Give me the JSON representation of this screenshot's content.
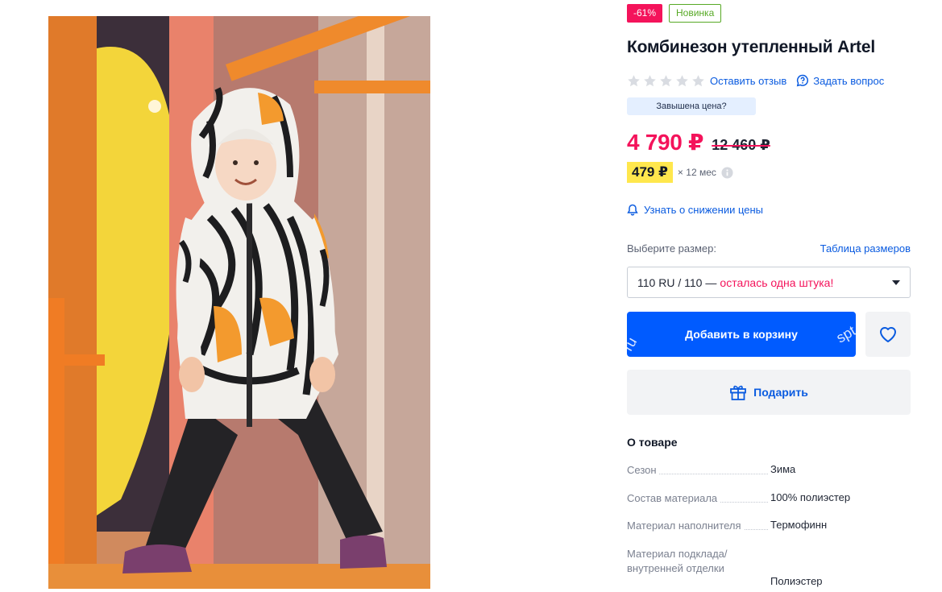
{
  "badges": {
    "discount": "-61%",
    "new": "Новинка"
  },
  "product": {
    "title": "Комбинезон утепленный Artel"
  },
  "rating": {
    "stars_filled": 0,
    "stars_total": 5,
    "review_link": "Оставить отзыв",
    "question_link": "Задать вопрос"
  },
  "overpriced_label": "Завышена цена?",
  "price": {
    "current": "4 790 ₽",
    "old": "12 460 ₽"
  },
  "installment": {
    "amount": "479 ₽",
    "term": "× 12 мес"
  },
  "price_alert": "Узнать о снижении цены",
  "size": {
    "label": "Выберите размер:",
    "table_link": "Таблица размеров",
    "selected": "110 RU / 110",
    "separator": "—",
    "stock_note": "осталась одна штука!"
  },
  "actions": {
    "add_to_cart": "Добавить в корзину",
    "gift": "Подарить",
    "cart_watermark_left": "ru",
    "cart_watermark_right": "spt"
  },
  "about": {
    "title": "О товаре",
    "specs": [
      {
        "name": "Сезон",
        "value": "Зима"
      },
      {
        "name": "Состав материала",
        "value": "100% полиэстер"
      },
      {
        "name": "Материал наполнителя",
        "value": "Термофинн"
      },
      {
        "name": "Материал подклада/внутренней отделки",
        "value": "Полиэстер"
      }
    ]
  },
  "colors": {
    "accent": "#005bff",
    "discount": "#f4135b",
    "new": "#57a925",
    "installment_bg": "#ffe74d"
  }
}
